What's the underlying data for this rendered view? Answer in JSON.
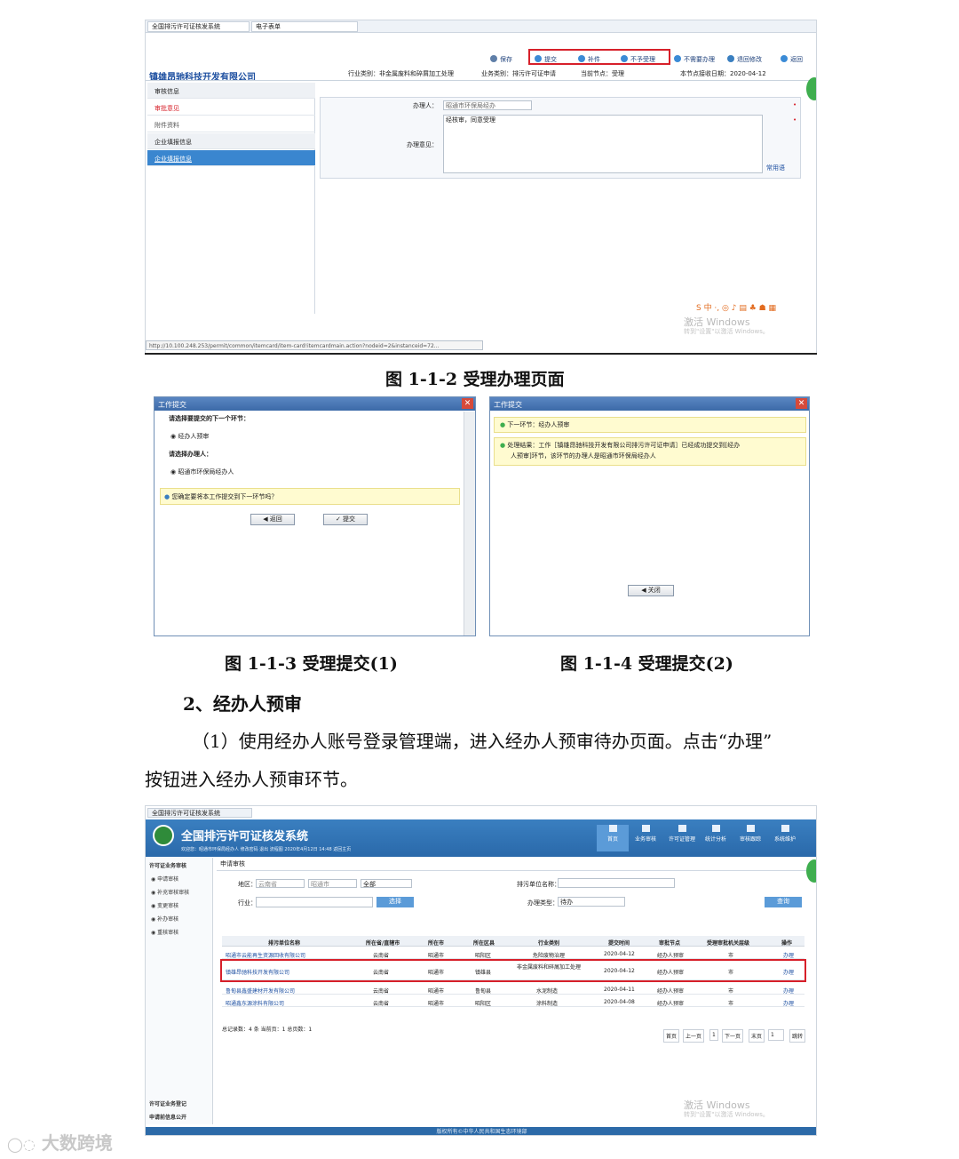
{
  "fig1": {
    "tabs": [
      "全国排污许可证核发系统",
      "电子表单"
    ],
    "toolbar": [
      "保存",
      "提交",
      "补件",
      "不予受理",
      "不需要办理",
      "退回修改",
      "返回"
    ],
    "company": "镇雄昂驰科技开发有限公司",
    "meta": [
      "行业类别：非金属废料和碎屑加工处理",
      "业务类别：排污许可证申请",
      "当前节点：受理",
      "本节点接收日期：2020-04-12"
    ],
    "left_items": [
      "审核信息",
      "审批意见",
      "附件资料",
      "企业填报信息",
      "企业填报信息"
    ],
    "form": {
      "handler_label": "办理人：",
      "handler_value": "昭通市环保局经办",
      "opinion_label": "办理意见：",
      "opinion_value": "经核审，同意受理",
      "common_words": "常用语"
    },
    "url": "http://10.100.248.253/permit/common/itemcard/item-card!itemcardmain.action?nodeid=2&instanceid=72...",
    "activate": "激活 Windows",
    "activate_sub": "转到\"设置\"以激活 Windows。",
    "caption": "图 1-1-2  受理办理页面"
  },
  "fig3": {
    "title": "工作提交",
    "close": "✕",
    "q1": "请选择要提交的下一个环节：",
    "opt1": "经办人预审",
    "q2": "请选择办理人：",
    "opt2": "昭通市环保局经办人",
    "confirm": "您确定要将本工作提交到下一环节吗？",
    "back": "返回",
    "submit": "提交",
    "caption": "图 1-1-3  受理提交(1)"
  },
  "fig4": {
    "title": "工作提交",
    "close": "✕",
    "line1": "下一环节：经办人预审",
    "line2a": "处理结果：工作［镇雄昂驰科技开发有限公司排污许可证申请］已经成功提交到[经办",
    "line2b": "人预审]环节，该环节的办理人是昭通市环保局经办人",
    "btn": "关闭",
    "caption": "图 1-1-4  受理提交(2)"
  },
  "section": {
    "heading": "2、经办人预审",
    "para_line1": "（1）使用经办人账号登录管理端，进入经办人预审待办页面。点击“办理”",
    "para_line2": "按钮进入经办人预审环节。"
  },
  "fig5": {
    "tab": "全国排污许可证核发系统",
    "system_title": "全国排污许可证核发系统",
    "userbar": "欢迎您：昭通市环保局经办人  修改密码  退出  流程图  2020年4月12日 14:48  返回主页",
    "nav": [
      "首页",
      "业务审核",
      "许可证管理",
      "统计分析",
      "审核跟踪",
      "系统维护"
    ],
    "side_group": "许可证业务审核",
    "side_items": [
      "申请审核",
      "补充审核审核",
      "变更审核",
      "补办审核",
      "重核审核"
    ],
    "side_bottom": [
      "许可证业务登记",
      "申请前信息公开"
    ],
    "breadcrumb": "申请审核",
    "filters": {
      "region_label": "地区：",
      "region_values": [
        "云南省",
        "昭通市",
        "全部"
      ],
      "unit_label": "排污单位名称：",
      "industry_label": "行业：",
      "select_btn": "选择",
      "type_label": "办理类型：",
      "type_value": "待办",
      "query_btn": "查询"
    },
    "columns": [
      "排污单位名称",
      "所在省/直辖市",
      "所在市",
      "所在区县",
      "行业类别",
      "提交时间",
      "审批节点",
      "受理审批机关层级",
      "操作"
    ],
    "rows": [
      [
        "昭通市云能再生资源回收有限公司",
        "云南省",
        "昭通市",
        "昭阳区",
        "危险废物治理",
        "2020-04-12",
        "经办人预审",
        "市",
        "办理"
      ],
      [
        "镇雄昂驰科技开发有限公司",
        "云南省",
        "昭通市",
        "镇雄县",
        "非金属废料和碎屑加工处理",
        "2020-04-12",
        "经办人预审",
        "市",
        "办理"
      ],
      [
        "鲁甸县鑫盛建材开发有限公司",
        "云南省",
        "昭通市",
        "鲁甸县",
        "水泥制造",
        "2020-04-11",
        "经办人预审",
        "市",
        "办理"
      ],
      [
        "昭通鑫东源涂料有限公司",
        "云南省",
        "昭通市",
        "昭阳区",
        "涂料制造",
        "2020-04-08",
        "经办人预审",
        "市",
        "办理"
      ]
    ],
    "summary": "总记录数：4 条  当前页：1  总页数：1",
    "pager": [
      "首页",
      "上一页",
      "1",
      "下一页",
      "末页",
      "1",
      "跳转"
    ],
    "activate": "激活 Windows",
    "activate_sub": "转到\"设置\"以激活 Windows。",
    "footer": "版权所有©中华人民共和国生态环境部"
  },
  "watermark": "大数跨境",
  "colors": {
    "accent_red": "#d7202a",
    "banner_blue": "#2a69aa",
    "link_blue": "#1e50a2"
  }
}
